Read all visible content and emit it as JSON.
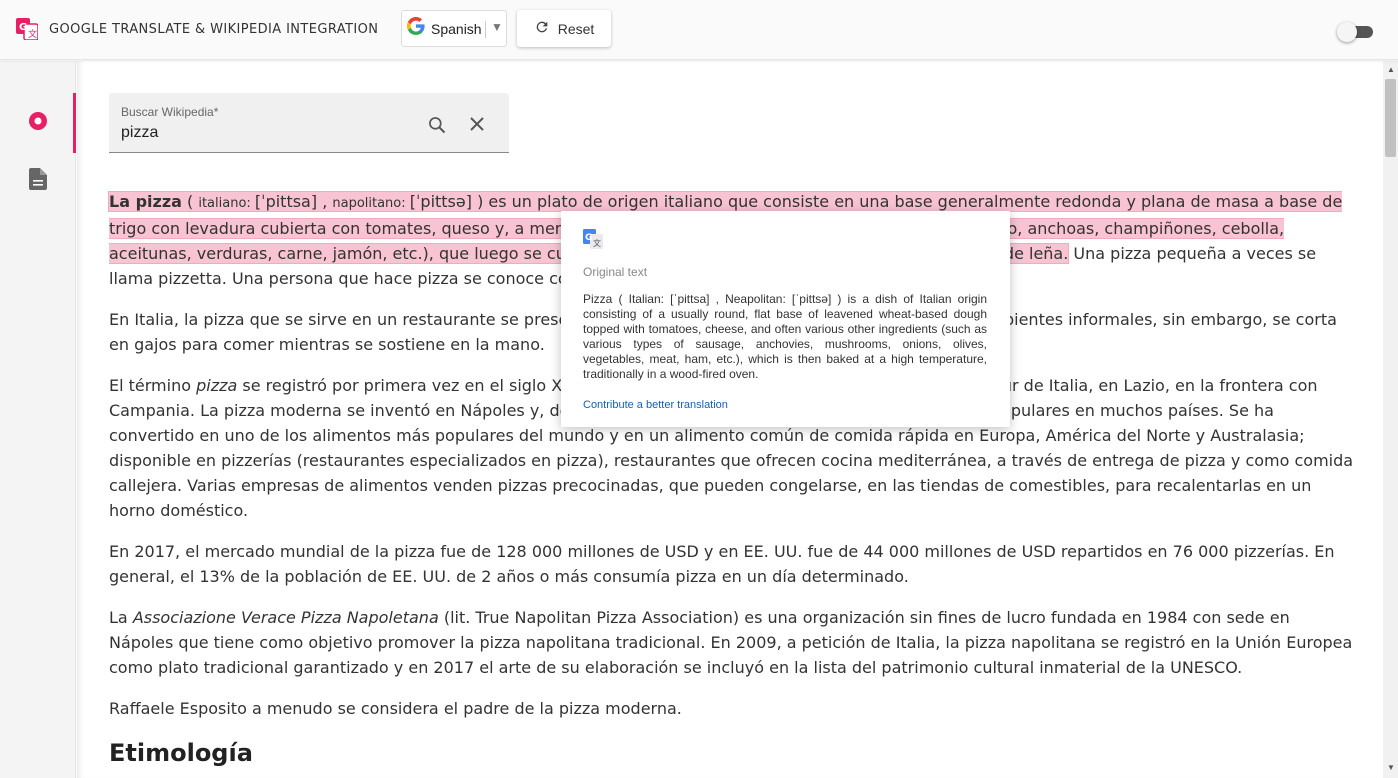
{
  "header": {
    "title": "GOOGLE TRANSLATE & WIKIPEDIA INTEGRATION",
    "language_label": "Spanish",
    "reset_label": "Reset",
    "dark_mode_enabled": false
  },
  "sidebar": {
    "items": [
      {
        "icon": "record-icon",
        "active": true
      },
      {
        "icon": "document-icon",
        "active": false
      }
    ]
  },
  "search": {
    "label": "Buscar Wikipedia*",
    "value": "pizza"
  },
  "article": {
    "p1_bold": "La pizza",
    "p1_open": " ( ",
    "p1_lang1": "italiano: ",
    "p1_ipa1": " [ˈpittsa] ",
    "p1_comma": ", ",
    "p1_lang2": "napolitano: ",
    "p1_ipa2": " [ˈpittsə] ",
    "p1_hl_rest": ") es un plato de origen italiano que consiste en una base generalmente redonda y plana de masa a base de trigo con levadura cubierta con tomates, queso y, a menudo, varios otros ingredientes (como embutidos, chorizo, anchoas, champiñones, cebolla, aceitunas, verduras, carne, jamón, etc.), que luego se cuece a alta temperatura, tradicionalmente en un horno de leña.",
    "p1_tail_a": " Una pizza pequeña a veces se llama pizzetta. Una persona que hace pizza se conoce como ",
    "p1_tail_bold": "pizzero",
    "p1_tail_b": ".",
    "p2": "En Italia, la pizza que se sirve en un restaurante se presenta sin cortar y se come con cuchillo y tenedor. En ambientes informales, sin embargo, se corta en gajos para comer mientras se sostiene en la mano.",
    "p3_a": "El término ",
    "p3_italic": "pizza",
    "p3_b": " se registró por primera vez en el siglo X en un manuscrito latino de la ciudad de Gaeta, en el sur de Italia, en Lazio, en la frontera con Campania. La pizza moderna se inventó en Nápoles y, desde entonces, el plato y sus variantes se han vuelto populares en muchos países. Se ha convertido en uno de los alimentos más populares del mundo y en un alimento común de comida rápida en Europa, América del Norte y Australasia; disponible en pizzerías (restaurantes especializados en pizza), restaurantes que ofrecen cocina mediterránea, a través de entrega de pizza y como comida callejera. Varias empresas de alimentos venden pizzas precocinadas, que pueden congelarse, en las tiendas de comestibles, para recalentarlas en un horno doméstico.",
    "p4": "En 2017, el mercado mundial de la pizza fue de 128 000 millones de USD y en EE. UU. fue de 44 000 millones de USD repartidos en 76 000 pizzerías. En general, el 13% de la población de EE. UU. de 2 años o más consumía pizza en un día determinado.",
    "p5_a": "La ",
    "p5_italic": "Associazione Verace Pizza Napoletana",
    "p5_b": " (lit. True Napolitan Pizza Association) es una organización sin fines de lucro fundada en 1984 con sede en Nápoles que tiene como objetivo promover la pizza napolitana tradicional. En 2009, a petición de Italia, la pizza napolitana se registró en la Unión Europea como plato tradicional garantizado y en 2017 el arte de su elaboración se incluyó en la lista del patrimonio cultural inmaterial de la UNESCO.",
    "p6": "Raffaele Esposito a menudo se considera el padre de la pizza moderna.",
    "h2": "Etimología"
  },
  "popup": {
    "title": "Original text",
    "text": "Pizza ( Italian: [ˈpittsa] , Neapolitan: [ˈpittsə] ) is a dish of Italian origin consisting of a usually round, flat base of leavened wheat-based dough topped with tomatoes, cheese, and often various other ingredients (such as various types of sausage, anchovies, mushrooms, onions, olives, vegetables, meat, ham, etc.), which is then baked at a high temperature, traditionally in a wood-fired oven.",
    "link": "Contribute a better translation"
  },
  "colors": {
    "accent": "#e91e63",
    "highlight": "#f8c3d3",
    "link": "#1a5fb4"
  }
}
